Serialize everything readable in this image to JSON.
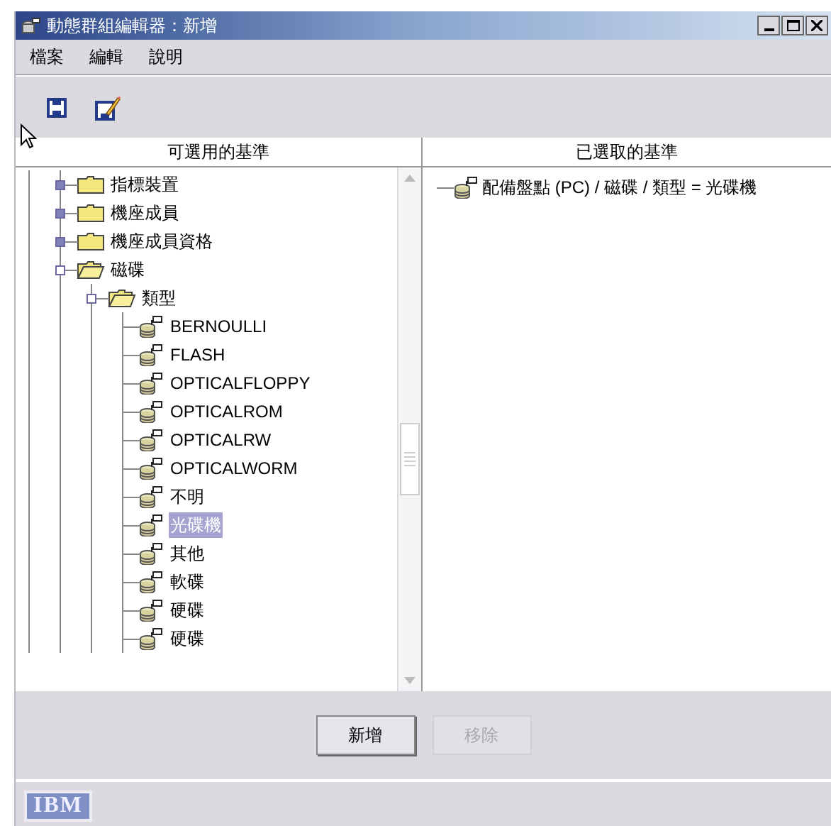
{
  "window": {
    "title": "動態群組編輯器：新增"
  },
  "menu": [
    "檔案",
    "編輯",
    "說明"
  ],
  "toolbar": [
    {
      "kind": "save"
    },
    {
      "kind": "edit"
    }
  ],
  "available_panel": {
    "heading": "可選用的基準",
    "tree": [
      {
        "label": "指標裝置",
        "kind": "folder",
        "expanded": false
      },
      {
        "label": "機座成員",
        "kind": "folder",
        "expanded": false
      },
      {
        "label": "機座成員資格",
        "kind": "folder",
        "expanded": false
      },
      {
        "label": "磁碟",
        "kind": "folder",
        "expanded": true,
        "children": [
          {
            "label": "類型",
            "kind": "folder",
            "expanded": true,
            "children": [
              {
                "label": "BERNOULLI",
                "kind": "leaf",
                "selected": false
              },
              {
                "label": "FLASH",
                "kind": "leaf",
                "selected": false
              },
              {
                "label": "OPTICALFLOPPY",
                "kind": "leaf",
                "selected": false
              },
              {
                "label": "OPTICALROM",
                "kind": "leaf",
                "selected": false
              },
              {
                "label": "OPTICALRW",
                "kind": "leaf",
                "selected": false
              },
              {
                "label": "OPTICALWORM",
                "kind": "leaf",
                "selected": false
              },
              {
                "label": "不明",
                "kind": "leaf",
                "selected": false
              },
              {
                "label": "光碟機",
                "kind": "leaf",
                "selected": true
              },
              {
                "label": "其他",
                "kind": "leaf",
                "selected": false
              },
              {
                "label": "軟碟",
                "kind": "leaf",
                "selected": false
              },
              {
                "label": "硬碟",
                "kind": "leaf",
                "selected": false
              },
              {
                "label": "硬碟",
                "kind": "leaf",
                "selected": false
              }
            ]
          }
        ]
      }
    ]
  },
  "selected_panel": {
    "heading": "已選取的基準",
    "items": [
      "配備盤點 (PC) / 磁碟 / 類型 = 光碟機"
    ]
  },
  "buttons": [
    {
      "label": "新增",
      "disabled": false
    },
    {
      "label": "移除",
      "disabled": true
    }
  ],
  "status_bar": {
    "logo": "IBM"
  }
}
